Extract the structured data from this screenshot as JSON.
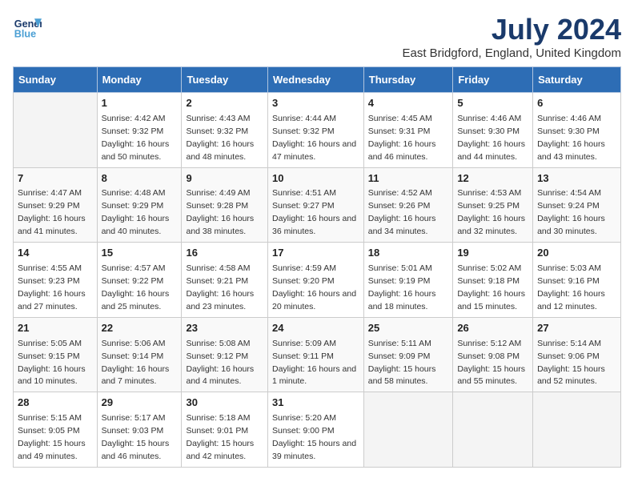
{
  "header": {
    "logo_line1": "General",
    "logo_line2": "Blue",
    "month": "July 2024",
    "location": "East Bridgford, England, United Kingdom"
  },
  "days_of_week": [
    "Sunday",
    "Monday",
    "Tuesday",
    "Wednesday",
    "Thursday",
    "Friday",
    "Saturday"
  ],
  "weeks": [
    [
      {
        "day": "",
        "detail": ""
      },
      {
        "day": "1",
        "detail": "Sunrise: 4:42 AM\nSunset: 9:32 PM\nDaylight: 16 hours and 50 minutes."
      },
      {
        "day": "2",
        "detail": "Sunrise: 4:43 AM\nSunset: 9:32 PM\nDaylight: 16 hours and 48 minutes."
      },
      {
        "day": "3",
        "detail": "Sunrise: 4:44 AM\nSunset: 9:32 PM\nDaylight: 16 hours and 47 minutes."
      },
      {
        "day": "4",
        "detail": "Sunrise: 4:45 AM\nSunset: 9:31 PM\nDaylight: 16 hours and 46 minutes."
      },
      {
        "day": "5",
        "detail": "Sunrise: 4:46 AM\nSunset: 9:30 PM\nDaylight: 16 hours and 44 minutes."
      },
      {
        "day": "6",
        "detail": "Sunrise: 4:46 AM\nSunset: 9:30 PM\nDaylight: 16 hours and 43 minutes."
      }
    ],
    [
      {
        "day": "7",
        "detail": "Sunrise: 4:47 AM\nSunset: 9:29 PM\nDaylight: 16 hours and 41 minutes."
      },
      {
        "day": "8",
        "detail": "Sunrise: 4:48 AM\nSunset: 9:29 PM\nDaylight: 16 hours and 40 minutes."
      },
      {
        "day": "9",
        "detail": "Sunrise: 4:49 AM\nSunset: 9:28 PM\nDaylight: 16 hours and 38 minutes."
      },
      {
        "day": "10",
        "detail": "Sunrise: 4:51 AM\nSunset: 9:27 PM\nDaylight: 16 hours and 36 minutes."
      },
      {
        "day": "11",
        "detail": "Sunrise: 4:52 AM\nSunset: 9:26 PM\nDaylight: 16 hours and 34 minutes."
      },
      {
        "day": "12",
        "detail": "Sunrise: 4:53 AM\nSunset: 9:25 PM\nDaylight: 16 hours and 32 minutes."
      },
      {
        "day": "13",
        "detail": "Sunrise: 4:54 AM\nSunset: 9:24 PM\nDaylight: 16 hours and 30 minutes."
      }
    ],
    [
      {
        "day": "14",
        "detail": "Sunrise: 4:55 AM\nSunset: 9:23 PM\nDaylight: 16 hours and 27 minutes."
      },
      {
        "day": "15",
        "detail": "Sunrise: 4:57 AM\nSunset: 9:22 PM\nDaylight: 16 hours and 25 minutes."
      },
      {
        "day": "16",
        "detail": "Sunrise: 4:58 AM\nSunset: 9:21 PM\nDaylight: 16 hours and 23 minutes."
      },
      {
        "day": "17",
        "detail": "Sunrise: 4:59 AM\nSunset: 9:20 PM\nDaylight: 16 hours and 20 minutes."
      },
      {
        "day": "18",
        "detail": "Sunrise: 5:01 AM\nSunset: 9:19 PM\nDaylight: 16 hours and 18 minutes."
      },
      {
        "day": "19",
        "detail": "Sunrise: 5:02 AM\nSunset: 9:18 PM\nDaylight: 16 hours and 15 minutes."
      },
      {
        "day": "20",
        "detail": "Sunrise: 5:03 AM\nSunset: 9:16 PM\nDaylight: 16 hours and 12 minutes."
      }
    ],
    [
      {
        "day": "21",
        "detail": "Sunrise: 5:05 AM\nSunset: 9:15 PM\nDaylight: 16 hours and 10 minutes."
      },
      {
        "day": "22",
        "detail": "Sunrise: 5:06 AM\nSunset: 9:14 PM\nDaylight: 16 hours and 7 minutes."
      },
      {
        "day": "23",
        "detail": "Sunrise: 5:08 AM\nSunset: 9:12 PM\nDaylight: 16 hours and 4 minutes."
      },
      {
        "day": "24",
        "detail": "Sunrise: 5:09 AM\nSunset: 9:11 PM\nDaylight: 16 hours and 1 minute."
      },
      {
        "day": "25",
        "detail": "Sunrise: 5:11 AM\nSunset: 9:09 PM\nDaylight: 15 hours and 58 minutes."
      },
      {
        "day": "26",
        "detail": "Sunrise: 5:12 AM\nSunset: 9:08 PM\nDaylight: 15 hours and 55 minutes."
      },
      {
        "day": "27",
        "detail": "Sunrise: 5:14 AM\nSunset: 9:06 PM\nDaylight: 15 hours and 52 minutes."
      }
    ],
    [
      {
        "day": "28",
        "detail": "Sunrise: 5:15 AM\nSunset: 9:05 PM\nDaylight: 15 hours and 49 minutes."
      },
      {
        "day": "29",
        "detail": "Sunrise: 5:17 AM\nSunset: 9:03 PM\nDaylight: 15 hours and 46 minutes."
      },
      {
        "day": "30",
        "detail": "Sunrise: 5:18 AM\nSunset: 9:01 PM\nDaylight: 15 hours and 42 minutes."
      },
      {
        "day": "31",
        "detail": "Sunrise: 5:20 AM\nSunset: 9:00 PM\nDaylight: 15 hours and 39 minutes."
      },
      {
        "day": "",
        "detail": ""
      },
      {
        "day": "",
        "detail": ""
      },
      {
        "day": "",
        "detail": ""
      }
    ]
  ]
}
